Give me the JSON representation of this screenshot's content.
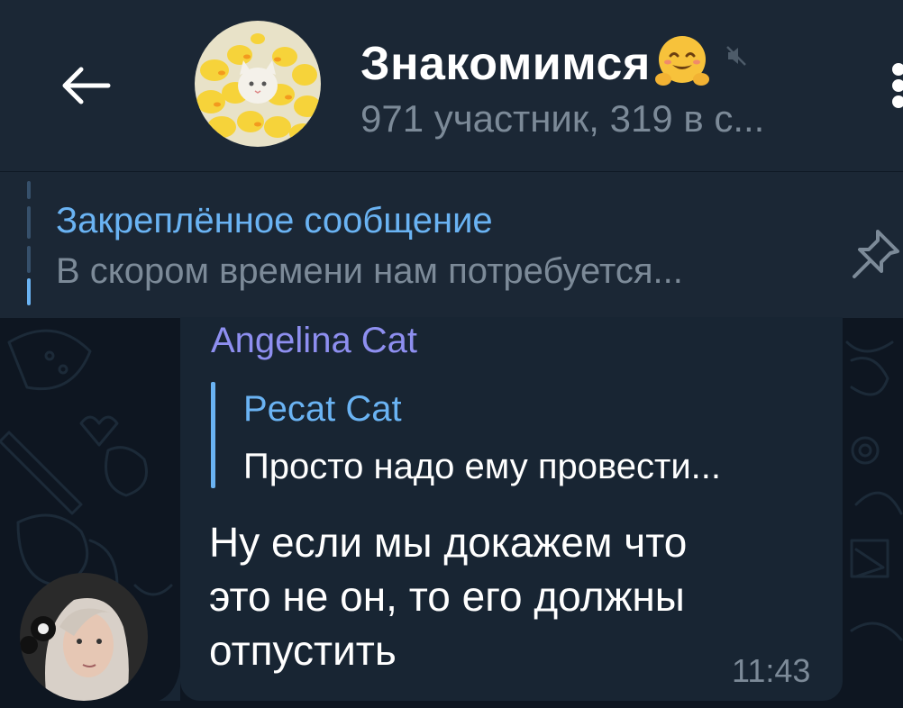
{
  "header": {
    "title": "Знакомимся",
    "title_emoji_icon": "hugging-face-emoji",
    "subtitle": "971 участник, 319 в с...",
    "back_icon": "arrow-left-icon",
    "mute_icon": "muted-speaker-icon",
    "menu_icon": "vertical-dots-icon"
  },
  "pinned": {
    "title": "Закреплённое сообщение",
    "text": "В скором времени нам потребуется...",
    "icon": "pin-icon"
  },
  "message": {
    "sender": "Angelina Cat",
    "reply": {
      "name": "Pecat Cat",
      "text": "Просто надо ему провести..."
    },
    "text": "Ну если мы докажем что\nэто не он, то его должны\nотпустить",
    "time": "11:43"
  },
  "colors": {
    "header_bg": "#1b2735",
    "chat_bg": "#0e1621",
    "bubble_bg": "#182533",
    "accent_blue": "#6ab3f3",
    "sender_purple": "#8e8ff0",
    "muted_text": "#7c8a98"
  }
}
